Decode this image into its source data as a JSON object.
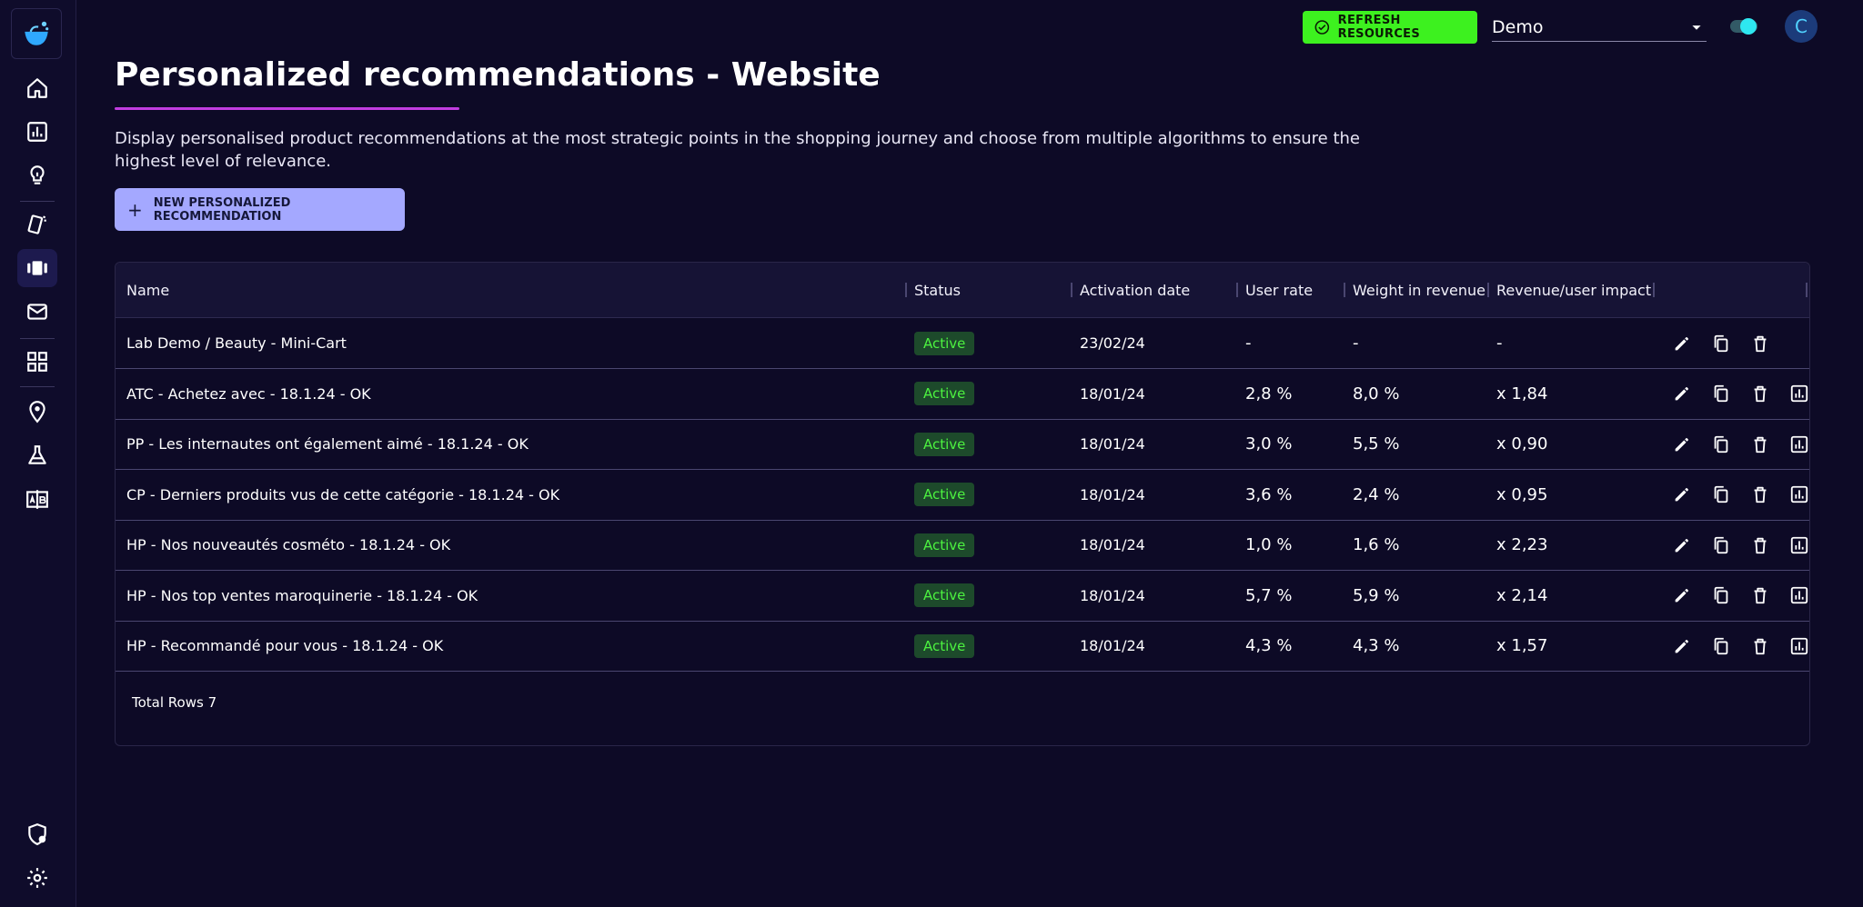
{
  "header": {
    "refresh_label": "REFRESH RESOURCES",
    "account_select_value": "Demo",
    "avatar_initial": "C"
  },
  "page": {
    "title": "Personalized recommendations - Website",
    "description": "Display personalised product recommendations at the most strategic points in the shopping journey and choose from multiple algorithms to ensure the highest level of relevance.",
    "new_button_label": "NEW PERSONALIZED RECOMMENDATION"
  },
  "table": {
    "columns": [
      "Name",
      "Status",
      "Activation date",
      "User rate",
      "Weight in revenue",
      "Revenue/user impact"
    ],
    "rows": [
      {
        "name": "Lab Demo / Beauty - Mini-Cart",
        "status": "Active",
        "date": "23/02/24",
        "user_rate": "-",
        "weight": "-",
        "impact": "-"
      },
      {
        "name": "ATC - Achetez avec - 18.1.24 - OK",
        "status": "Active",
        "date": "18/01/24",
        "user_rate": "2,8 %",
        "weight": "8,0 %",
        "impact": "x 1,84"
      },
      {
        "name": "PP - Les internautes ont également aimé - 18.1.24 - OK",
        "status": "Active",
        "date": "18/01/24",
        "user_rate": "3,0 %",
        "weight": "5,5 %",
        "impact": "x 0,90"
      },
      {
        "name": "CP - Derniers produits vus de cette catégorie - 18.1.24 - OK",
        "status": "Active",
        "date": "18/01/24",
        "user_rate": "3,6 %",
        "weight": "2,4 %",
        "impact": "x 0,95"
      },
      {
        "name": "HP - Nos nouveautés cosméto - 18.1.24 - OK",
        "status": "Active",
        "date": "18/01/24",
        "user_rate": "1,0 %",
        "weight": "1,6 %",
        "impact": "x 2,23"
      },
      {
        "name": "HP - Nos top ventes maroquinerie - 18.1.24 - OK",
        "status": "Active",
        "date": "18/01/24",
        "user_rate": "5,7 %",
        "weight": "5,9 %",
        "impact": "x 2,14"
      },
      {
        "name": "HP - Recommandé pour vous - 18.1.24 - OK",
        "status": "Active",
        "date": "18/01/24",
        "user_rate": "4,3 %",
        "weight": "4,3 %",
        "impact": "x 1,57"
      }
    ],
    "total_rows_label": "Total Rows 7"
  },
  "sidebar": {
    "icons": [
      "home-icon",
      "chart-icon",
      "lightbulb-icon",
      "cards-icon",
      "carousel-icon",
      "mail-icon",
      "grid-icon",
      "location-icon",
      "flask-icon",
      "ab-test-icon",
      "shield-icon",
      "gear-icon"
    ]
  },
  "colors": {
    "background": "#0d0a26",
    "accent_green": "#3df11f",
    "button_purple": "#a4a8ff",
    "title_underline": "#c13de0",
    "status_active": "#4cf240"
  }
}
